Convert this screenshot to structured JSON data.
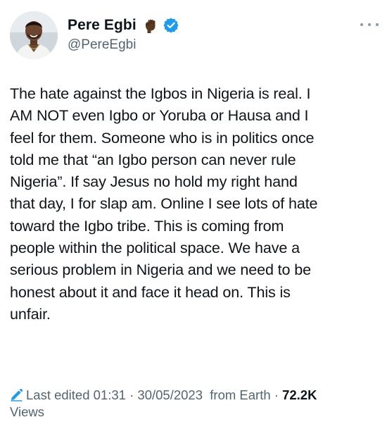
{
  "author": {
    "display_name": "Pere Egbi",
    "handle": "@PereEgbi",
    "emoji": "raised-fist-dark-skin-tone-icon",
    "verified": true
  },
  "tweet": {
    "text": "The hate against the Igbos in Nigeria is real. I\nAM NOT even Igbo or Yoruba or Hausa and I\nfeel for them. Someone who is in politics once\ntold me that “an Igbo person can never rule\nNigeria”. If say Jesus no hold my right hand\nthat day, I for slap am.  Online I see lots of hate\ntoward the Igbo tribe.  This is coming from\npeople within the political space. We have a\nserious problem in Nigeria and we need to be\nhonest about it and face it head on. This is\nunfair."
  },
  "meta": {
    "edited_label": "Last edited",
    "time": "01:31",
    "separator": "·",
    "date": "30/05/2023",
    "source": "from Earth",
    "views_count": "72.2K",
    "views_label": "Views"
  },
  "colors": {
    "text": "#0f1419",
    "secondary": "#536471",
    "verified_blue": "#1d9bf0",
    "background": "#ffffff"
  }
}
